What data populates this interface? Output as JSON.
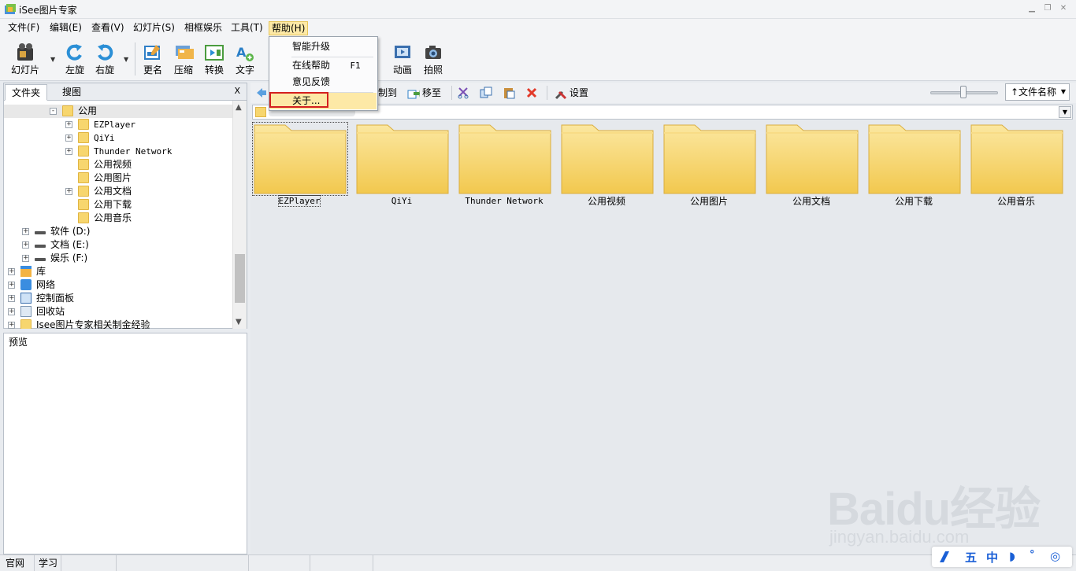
{
  "window": {
    "title": "iSee图片专家"
  },
  "menu": [
    {
      "label": "文件(F)"
    },
    {
      "label": "编辑(E)"
    },
    {
      "label": "查看(V)"
    },
    {
      "label": "幻灯片(S)"
    },
    {
      "label": "相框娱乐"
    },
    {
      "label": "工具(T)"
    },
    {
      "label": "帮助(H)"
    }
  ],
  "toolbar": [
    {
      "label": "幻灯片",
      "icon": "film-icon"
    },
    {
      "label": "左旋",
      "icon": "rotate-left-icon"
    },
    {
      "label": "右旋",
      "icon": "rotate-right-icon"
    },
    {
      "label": "更名",
      "icon": "rename-icon"
    },
    {
      "label": "压缩",
      "icon": "compress-icon"
    },
    {
      "label": "转换",
      "icon": "convert-icon"
    },
    {
      "label": "文字",
      "icon": "text-icon"
    },
    {
      "label": "动画",
      "icon": "animation-icon"
    },
    {
      "label": "拍照",
      "icon": "camera-icon"
    }
  ],
  "help_menu": {
    "items": [
      {
        "label": "智能升级",
        "shortcut": ""
      },
      {
        "label": "在线帮助",
        "shortcut": "F1"
      },
      {
        "label": "意见反馈",
        "shortcut": ""
      },
      {
        "label": "关于...",
        "shortcut": ""
      }
    ]
  },
  "left_panel": {
    "tabs": [
      "文件夹",
      "搜图"
    ],
    "close": "X",
    "tree": [
      {
        "label": "公用",
        "level": 1,
        "expander": "−",
        "icon": "folder"
      },
      {
        "label": "EZPlayer",
        "level": 2,
        "expander": "+",
        "icon": "folder"
      },
      {
        "label": "QiYi",
        "level": 2,
        "expander": "+",
        "icon": "folder"
      },
      {
        "label": "Thunder Network",
        "level": 2,
        "expander": "+",
        "icon": "folder"
      },
      {
        "label": "公用视频",
        "level": 2,
        "expander": "",
        "icon": "folder"
      },
      {
        "label": "公用图片",
        "level": 2,
        "expander": "",
        "icon": "folder"
      },
      {
        "label": "公用文档",
        "level": 2,
        "expander": "+",
        "icon": "folder"
      },
      {
        "label": "公用下载",
        "level": 2,
        "expander": "",
        "icon": "folder"
      },
      {
        "label": "公用音乐",
        "level": 2,
        "expander": "",
        "icon": "folder"
      },
      {
        "label": "软件 (D:)",
        "level": 0,
        "expander": "+",
        "icon": "drive"
      },
      {
        "label": "文档 (E:)",
        "level": 0,
        "expander": "+",
        "icon": "drive"
      },
      {
        "label": "娱乐 (F:)",
        "level": 0,
        "expander": "+",
        "icon": "drive"
      },
      {
        "label": "库",
        "level": -1,
        "expander": "+",
        "icon": "library"
      },
      {
        "label": "网络",
        "level": -1,
        "expander": "+",
        "icon": "network"
      },
      {
        "label": "控制面板",
        "level": -1,
        "expander": "+",
        "icon": "control-panel"
      },
      {
        "label": "回收站",
        "level": -1,
        "expander": "+",
        "icon": "recycle-bin"
      },
      {
        "label": "Isee图片专家相关制金经验",
        "level": -1,
        "expander": "+",
        "icon": "folder"
      }
    ]
  },
  "preview": {
    "label": "预览"
  },
  "right_toolbar": {
    "copy_to": "制到",
    "move_to": "移至",
    "settings": "设置",
    "sort": "↑文件名称"
  },
  "files": [
    {
      "name": "EZPlayer",
      "mono": true
    },
    {
      "name": "QiYi",
      "mono": true
    },
    {
      "name": "Thunder Network",
      "mono": true
    },
    {
      "name": "公用视频",
      "mono": false
    },
    {
      "name": "公用图片",
      "mono": false
    },
    {
      "name": "公用文档",
      "mono": false
    },
    {
      "name": "公用下载",
      "mono": false
    },
    {
      "name": "公用音乐",
      "mono": false
    }
  ],
  "statusbar": [
    "官网",
    "学习"
  ],
  "watermark": {
    "main": "Baidu经验",
    "sub": "jingyan.baidu.com"
  },
  "ime": [
    "五",
    "中"
  ],
  "colors": {
    "folder": "#f7d66e",
    "menu_highlight": "#fde9a6",
    "annotation_box": "#d42020"
  }
}
